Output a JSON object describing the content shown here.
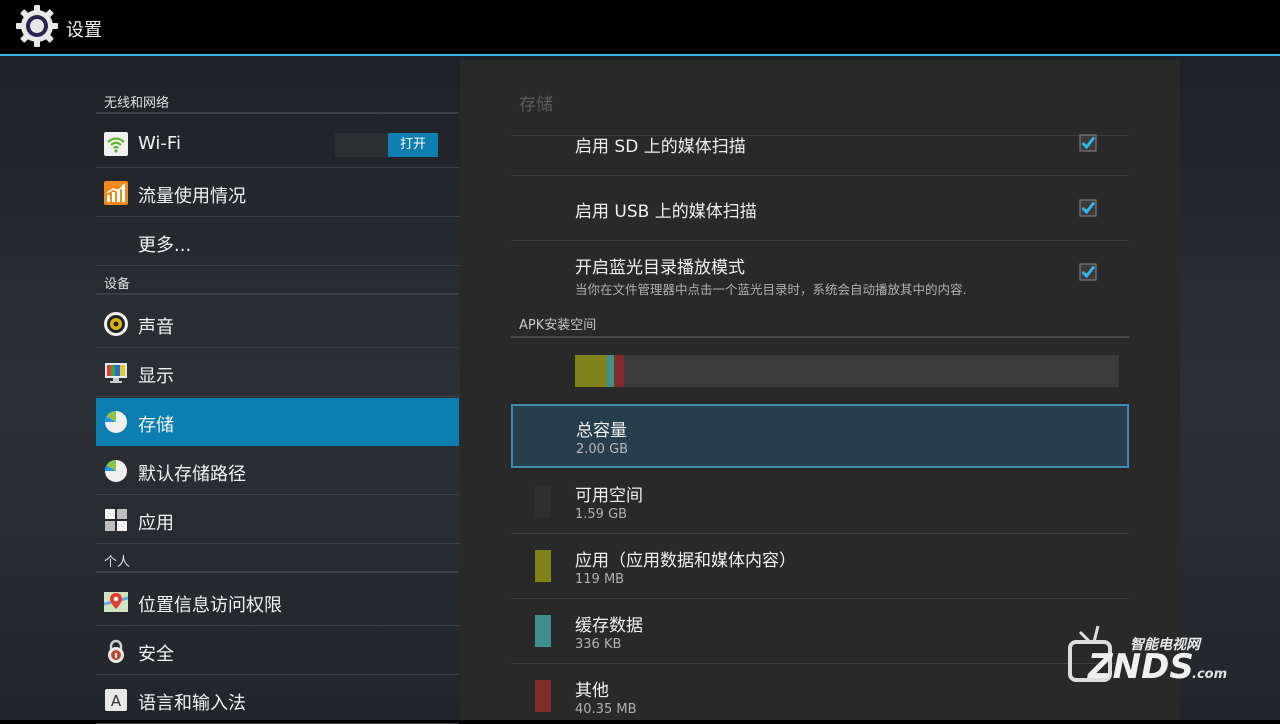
{
  "app": {
    "title": "设置"
  },
  "left": {
    "categories": {
      "wireless": "无线和网络",
      "device": "设备",
      "personal": "个人"
    },
    "items": [
      {
        "label": "Wi-Fi",
        "icon": "wifi-icon"
      },
      {
        "label": "流量使用情况",
        "icon": "data-usage-icon"
      },
      {
        "label": "更多...",
        "icon": ""
      },
      {
        "label": "声音",
        "icon": "speaker-icon"
      },
      {
        "label": "显示",
        "icon": "display-icon"
      },
      {
        "label": "存储",
        "icon": "storage-pie-icon",
        "selected": true
      },
      {
        "label": "默认存储路径",
        "icon": "storage-pie-icon"
      },
      {
        "label": "应用",
        "icon": "apps-grid-icon"
      },
      {
        "label": "位置信息访问权限",
        "icon": "location-icon"
      },
      {
        "label": "安全",
        "icon": "lock-icon"
      },
      {
        "label": "语言和输入法",
        "icon": "keyboard-a-icon"
      }
    ],
    "wifi_toggle": "打开"
  },
  "detail": {
    "title": "存储",
    "media_scan_sd": "启用 SD 上的媒体扫描",
    "media_scan_usb": "启用 USB 上的媒体扫描",
    "bluray": {
      "title": "开启蓝光目录播放模式",
      "summary": "当你在文件管理器中点击一个蓝光目录时，系统会自动播放其中的内容."
    },
    "apk_section": "APK安装空间",
    "usage_fractions": {
      "apps": 0.058,
      "cache": 0.012,
      "other": 0.018
    },
    "total": {
      "title": "总容量",
      "value": "2.00 GB"
    },
    "available": {
      "title": "可用空间",
      "value": "1.59 GB"
    },
    "apps": {
      "title": "应用（应用数据和媒体内容）",
      "value": "119 MB"
    },
    "cache": {
      "title": "缓存数据",
      "value": "336 KB"
    },
    "other": {
      "title": "其他",
      "value": "40.35 MB"
    }
  },
  "colors": {
    "accent": "#33b5e5",
    "selected": "#0c7eaf",
    "available": "#2f2f2f",
    "apps": "#7e8219",
    "cache": "#3f8f8f",
    "other": "#812b2b"
  },
  "watermark": {
    "cn": "智能电视网",
    "en": "ZNDS",
    "suffix": ".com"
  }
}
